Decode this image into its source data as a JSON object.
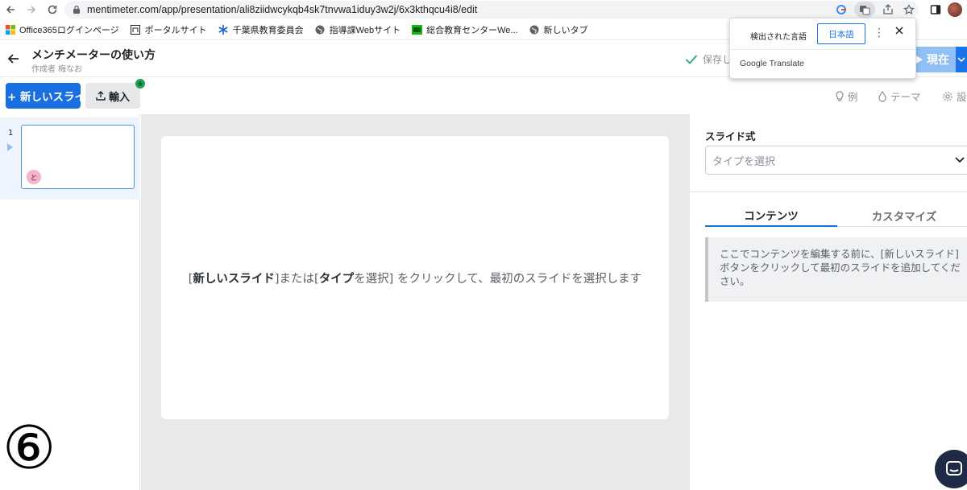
{
  "browser": {
    "url": "mentimeter.com/app/presentation/ali8ziidwcykqb4sk7tnvwa1iduy3w2j/6x3kthqcu4i8/edit",
    "bookmarks": [
      {
        "label": "Office365ログインページ"
      },
      {
        "label": "ポータルサイト"
      },
      {
        "label": "千葉県教育委員会"
      },
      {
        "label": "指導課Webサイト"
      },
      {
        "label": "総合教育センターWe..."
      },
      {
        "label": "新しいタブ"
      }
    ]
  },
  "translate_popup": {
    "detected_label": "検出された言語",
    "target_label": "日本語",
    "brand": "Google Translate"
  },
  "header": {
    "title": "メンチメーターの使い方",
    "author": "作成者 梅なお",
    "saved_label": "保存し",
    "present_label": "現在"
  },
  "toolbar": {
    "new_slide_label": "+ 新しいスライド",
    "import_label": "輸入",
    "examples_label": "例",
    "themes_label": "テーマ",
    "settings_label": "設"
  },
  "slides": [
    {
      "number": "1",
      "avatar_initial": "と"
    }
  ],
  "canvas": {
    "msg_bold1": "新しいスライド",
    "msg_part1": "]または[",
    "msg_bold2": "タイプ",
    "msg_part2": "を選択] をクリックして、最初のスライドを選択します"
  },
  "overlay": {
    "step_marker": "⑥"
  },
  "right_panel": {
    "type_label": "スライド式",
    "type_placeholder": "タイプを選択",
    "tab_content": "コンテンツ",
    "tab_customize": "カスタマイズ",
    "info_text": "ここでコンテンツを編集する前に、[新しいスライド]ボタンをクリックして最初のスライドを追加してください。"
  },
  "colors": {
    "accent": "#1a6fe0",
    "present_disabled": "#8fbff5",
    "canvas_bg": "#e9e9ea"
  }
}
